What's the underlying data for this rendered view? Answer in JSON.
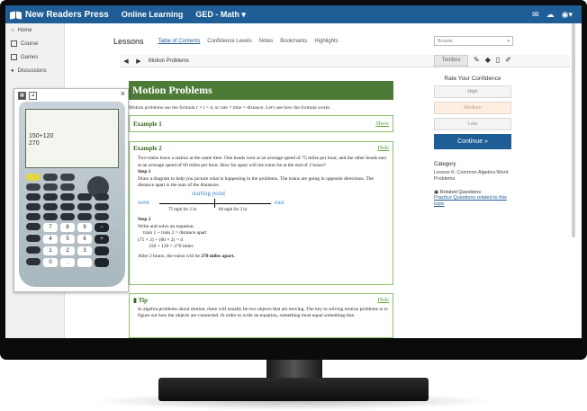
{
  "topbar": {
    "brand": "New Readers Press",
    "nav": [
      "Online Learning",
      "GED - Math ▾"
    ],
    "icons": [
      "mail-icon",
      "cloud-icon",
      "user-icon"
    ]
  },
  "sidebar": {
    "items": [
      {
        "label": "Home",
        "icon": "home-icon"
      },
      {
        "label": "Course",
        "icon": "course-icon"
      },
      {
        "label": "Games",
        "icon": "games-icon"
      },
      {
        "label": "Discussions",
        "icon": "discussions-icon"
      }
    ]
  },
  "lessonbar": {
    "title": "Lessons",
    "tabs": [
      "Table of Contents",
      "Confidence Levels",
      "Notes",
      "Bookmarks",
      "Highlights"
    ],
    "browse_placeholder": "Browse"
  },
  "navrow": {
    "prev": "◀",
    "next": "▶",
    "title": "Motion Problems",
    "toolbar_label": "Toolbox"
  },
  "lesson": {
    "title": "Motion Problems",
    "intro": "Motion problems use the formula r × t = d, or rate × time = distance. Let's see how the formula works.",
    "example1": {
      "title": "Example 1",
      "toggle": "Show"
    },
    "example2": {
      "title": "Example 2",
      "toggle": "Hide",
      "problem": "Two trains leave a station at the same time. One heads west at an average speed of 75 miles per hour, and the other heads east at an average speed of 60 miles per hour. How far apart will the trains be at the end of 2 hours?",
      "step1_label": "Step 1",
      "step1_text": "Draw a diagram to help you picture what is happening in the problems. The trains are going in opposite directions. The distance apart is the sum of the distances.",
      "diagram": {
        "start": "starting point",
        "west": "west",
        "east": "east",
        "left_label": "75 mph for 2 hr",
        "right_label": "60 mph for 2 hr"
      },
      "step2_label": "Step 2",
      "step2_text": "Write and solve an equation.",
      "eq1": "train 1 + train 2 = distance apart",
      "eq2": "(75 × 2) + (60 × 2) = d",
      "eq3": "150 + 120 = 270 miles",
      "conclusion_prefix": "After 2 hours, the trains will be",
      "conclusion_bold": "270 miles apart."
    },
    "tip": {
      "title": "Tip",
      "toggle": "Hide",
      "text": "In algebra problems about motion, there will usually be two objects that are moving. The key to solving motion problems is to figure out how the objects are connected. In order to write an equation, something must equal something else."
    }
  },
  "confidence": {
    "title": "Rate Your Confidence",
    "levels": [
      "High",
      "Medium",
      "Low"
    ],
    "continue": "Continue »"
  },
  "category": {
    "title": "Category",
    "value": "Lesson 6: Common Algebra Word Problems",
    "related_title": "Related Questions:",
    "related_link": "Practice Questions related to this topic"
  },
  "calculator": {
    "expression": "150+120",
    "result": "270",
    "tabs": [
      "calculator-icon",
      "protractor-icon"
    ],
    "close": "×"
  },
  "colors": {
    "topbar": "#1f5d96",
    "lesson_header": "#4c7a37",
    "accent_green": "#8cc06b",
    "continue": "#1f5d96"
  }
}
